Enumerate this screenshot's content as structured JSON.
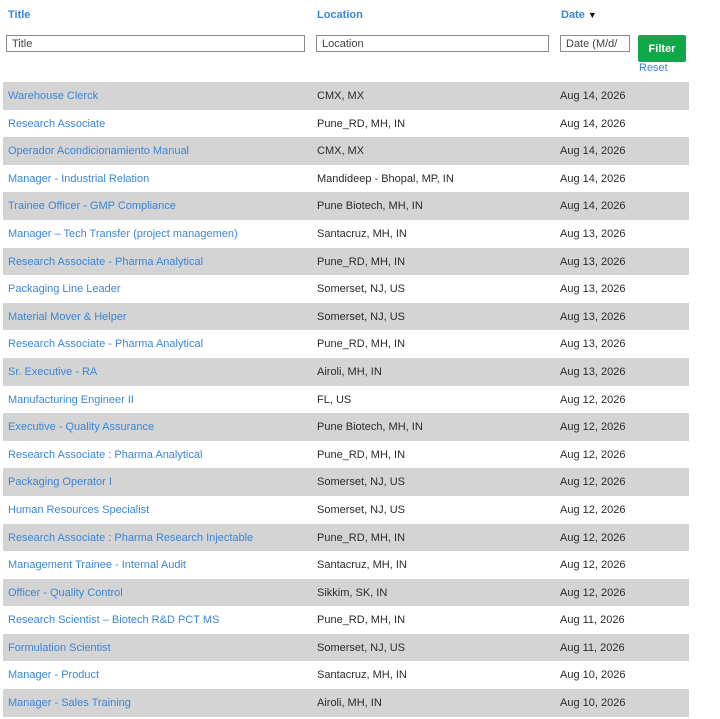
{
  "header": {
    "title_label": "Title",
    "location_label": "Location",
    "date_label": "Date",
    "sort_icon": "sort-desc-icon"
  },
  "filters": {
    "title_placeholder": "Title",
    "location_placeholder": "Location",
    "date_placeholder": "Date (M/d/",
    "filter_label": "Filter",
    "reset_label": "Reset"
  },
  "colors": {
    "link": "#3a86d8",
    "filter_button": "#12a84a",
    "row_stripe": "#d4d4d4"
  },
  "rows": [
    {
      "title": "Warehouse Clerck",
      "location": "CMX, MX",
      "date": "Aug 14, 2026"
    },
    {
      "title": "Research Associate",
      "location": "Pune_RD, MH, IN",
      "date": "Aug 14, 2026"
    },
    {
      "title": "Operador Acondicionamiento Manual",
      "location": "CMX, MX",
      "date": "Aug 14, 2026"
    },
    {
      "title": "Manager - Industrial Relation",
      "location": "Mandideep - Bhopal, MP, IN",
      "date": "Aug 14, 2026"
    },
    {
      "title": "Trainee Officer - GMP Compliance",
      "location": "Pune Biotech, MH, IN",
      "date": "Aug 14, 2026"
    },
    {
      "title": "Manager – Tech Transfer (project managemen)",
      "location": "Santacruz, MH, IN",
      "date": "Aug 13, 2026"
    },
    {
      "title": "Research Associate - Pharma Analytical",
      "location": "Pune_RD, MH, IN",
      "date": "Aug 13, 2026"
    },
    {
      "title": "Packaging Line Leader",
      "location": "Somerset, NJ, US",
      "date": "Aug 13, 2026"
    },
    {
      "title": "Material Mover & Helper",
      "location": "Somerset, NJ, US",
      "date": "Aug 13, 2026"
    },
    {
      "title": "Research Associate - Pharma Analytical",
      "location": "Pune_RD, MH, IN",
      "date": "Aug 13, 2026"
    },
    {
      "title": "Sr. Executive - RA",
      "location": "Airoli, MH, IN",
      "date": "Aug 13, 2026"
    },
    {
      "title": "Manufacturing Engineer II",
      "location": "FL, US",
      "date": "Aug 12, 2026"
    },
    {
      "title": "Executive - Quality Assurance",
      "location": "Pune Biotech, MH, IN",
      "date": "Aug 12, 2026"
    },
    {
      "title": "Research Associate : Pharma Analytical",
      "location": "Pune_RD, MH, IN",
      "date": "Aug 12, 2026"
    },
    {
      "title": "Packaging Operator I",
      "location": "Somerset, NJ, US",
      "date": "Aug 12, 2026"
    },
    {
      "title": "Human Resources Specialist",
      "location": "Somerset, NJ, US",
      "date": "Aug 12, 2026"
    },
    {
      "title": "Research Associate : Pharma Research Injectable",
      "location": "Pune_RD, MH, IN",
      "date": "Aug 12, 2026"
    },
    {
      "title": "Management Trainee - Internal Audit",
      "location": "Santacruz, MH, IN",
      "date": "Aug 12, 2026"
    },
    {
      "title": "Officer - Quality Control",
      "location": "Sikkim, SK, IN",
      "date": "Aug 12, 2026"
    },
    {
      "title": "Research Scientist – Biotech R&D PCT MS",
      "location": "Pune_RD, MH, IN",
      "date": "Aug 11, 2026"
    },
    {
      "title": "Formulation Scientist",
      "location": "Somerset, NJ, US",
      "date": "Aug 11, 2026"
    },
    {
      "title": "Manager - Product",
      "location": "Santacruz, MH, IN",
      "date": "Aug 10, 2026"
    },
    {
      "title": "Manager - Sales Training",
      "location": "Airoli, MH, IN",
      "date": "Aug 10, 2026"
    }
  ]
}
